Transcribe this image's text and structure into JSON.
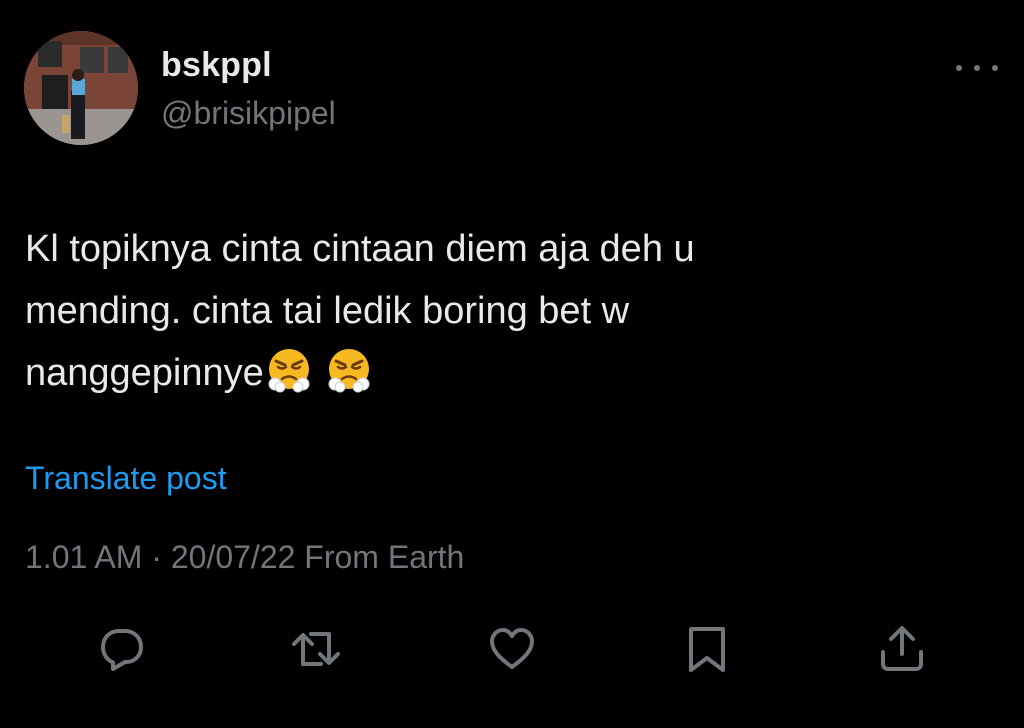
{
  "author": {
    "display_name": "bskppl",
    "handle": "@brisikpipel",
    "avatar_icon": "profile-photo"
  },
  "post": {
    "lines": [
      "Kl topiknya cinta cintaan diem aja deh u",
      "mending. cinta tai ledik boring bet w",
      "nanggepinnye"
    ],
    "emojis": [
      "face-with-steam-from-nose",
      "face-with-steam-from-nose"
    ],
    "translate_label": "Translate post",
    "time": "1.01 AM",
    "separator": " · ",
    "date": "20/07/22",
    "source": " From Earth"
  },
  "actions": [
    {
      "name": "reply",
      "icon": "reply-icon"
    },
    {
      "name": "repost",
      "icon": "repost-icon"
    },
    {
      "name": "like",
      "icon": "heart-icon"
    },
    {
      "name": "bookmark",
      "icon": "bookmark-icon"
    },
    {
      "name": "share",
      "icon": "share-icon"
    }
  ],
  "colors": {
    "background": "#000000",
    "text_primary": "#e7e9ea",
    "text_secondary": "#71767b",
    "link": "#1d9bf0"
  }
}
